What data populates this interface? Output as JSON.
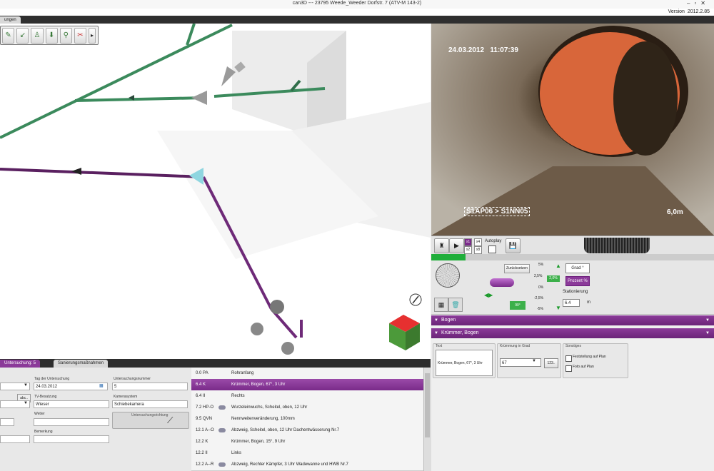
{
  "window": {
    "title": "can3D --- 23795 Weede_Weeder Dorfstr. 7 (ATV-M 143-2)",
    "version_label": "Version",
    "version_value": "2012.2.85"
  },
  "main_tab": {
    "label": "ungen"
  },
  "video": {
    "date": "24.03.2012",
    "time": "11:07:39",
    "section": "S1AP06 > S1NN05",
    "distance": "6,0m",
    "speeds": [
      "x1",
      "x4",
      "x2",
      "x8"
    ],
    "autoplay_label": "Autoplay"
  },
  "inclination": {
    "reset_label": "Zurücksetzen",
    "scale": [
      "5%",
      "2,5%",
      "0%",
      "-2,5%",
      "-5%"
    ],
    "current_value": "2,0%",
    "angle_readout": "90°",
    "unit_grad_label": "Grad °",
    "unit_percent_label": "Prozent %",
    "stationing_label": "Stationierung",
    "stationing_value": "6.4",
    "stationing_unit": "m"
  },
  "sections": {
    "bogen_label": "Bogen",
    "kruemmer_label": "Krümmer, Bogen"
  },
  "detail": {
    "text_caption": "Text",
    "text_value": "Krümmer, Bogen, 67°, 3 Uhr",
    "curvature_caption": "Krümmung in Grad",
    "curvature_value": "67",
    "curvature_btn": "123..",
    "misc_caption": "Sonstiges",
    "checkbox_1": "Feststellung auf Plan",
    "checkbox_2": "Foto auf Plan"
  },
  "bottom_tabs": {
    "tab1": "Untersuchung: 5",
    "tab2": "Sanierungsmaßnahmen"
  },
  "form": {
    "date_label": "Tag der Untersuchung",
    "date_value": "24.03.2012",
    "num_label": "Untersuchungsnummer",
    "num_value": "5",
    "abc_label": "abc..",
    "tv_label": "TV-Besatzung",
    "tv_value": "Wieser",
    "camera_label": "Kamerasystem",
    "camera_value": "Schiebekamera",
    "weather_label": "Wetter",
    "direction_label": "Untersuchungsrichtung",
    "remark_label": "Bemerkung"
  },
  "observations": [
    {
      "code": "0.0 PA",
      "desc": "Rohranfang",
      "icon": false,
      "selected": false
    },
    {
      "code": "6.4 K",
      "desc": "Krümmer, Bogen, 67°, 3 Uhr",
      "icon": false,
      "selected": true
    },
    {
      "code": "6.4 II",
      "desc": "Rechts",
      "icon": false,
      "selected": false
    },
    {
      "code": "7.2 HP-O",
      "desc": "Wurzeleinwuchs, Scheitel, oben, 12 Uhr",
      "icon": true,
      "selected": false
    },
    {
      "code": "9.5 QVN",
      "desc": "Nennweitenveränderung, 100mm",
      "icon": false,
      "selected": false
    },
    {
      "code": "12.1 A--O",
      "desc": "Abzweig, Scheitel, oben, 12 Uhr Dachentwässerung Nr.7",
      "icon": true,
      "selected": false
    },
    {
      "code": "12.2 K",
      "desc": "Krümmer, Bogen, 15°, 9 Uhr",
      "icon": false,
      "selected": false
    },
    {
      "code": "12.2 II",
      "desc": "Links",
      "icon": false,
      "selected": false
    },
    {
      "code": "12.2 A--R",
      "desc": "Abzweig, Rechter Kämpfer, 3 Uhr Wadewanne und HWB Nr.7",
      "icon": true,
      "selected": false
    }
  ]
}
